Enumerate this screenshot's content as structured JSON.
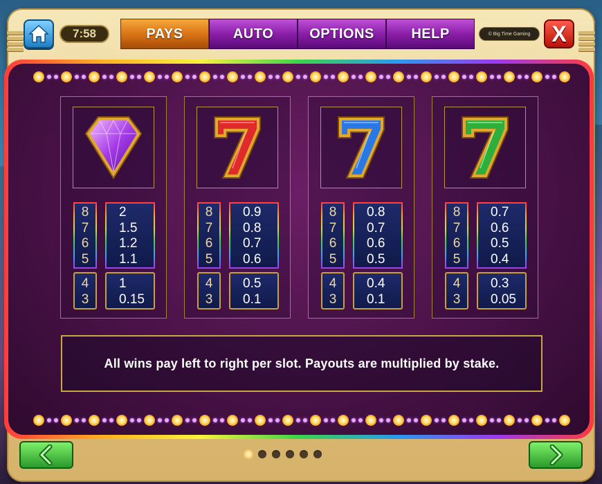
{
  "header": {
    "clock": "7:58",
    "tabs": [
      {
        "label": "PAYS",
        "active": true
      },
      {
        "label": "AUTO",
        "active": false
      },
      {
        "label": "OPTIONS",
        "active": false
      },
      {
        "label": "HELP",
        "active": false
      }
    ],
    "brand": "© Big Time Gaming",
    "close_label": "X"
  },
  "paytable": [
    {
      "symbol": "purple-diamond",
      "symbol_color": "#a63ce8",
      "counts_high": [
        "8",
        "7",
        "6",
        "5"
      ],
      "payouts_high": [
        "2",
        "1.5",
        "1.2",
        "1.1"
      ],
      "counts_low": [
        "4",
        "3"
      ],
      "payouts_low": [
        "1",
        "0.15"
      ]
    },
    {
      "symbol": "red-seven",
      "symbol_color": "#e02a2a",
      "counts_high": [
        "8",
        "7",
        "6",
        "5"
      ],
      "payouts_high": [
        "0.9",
        "0.8",
        "0.7",
        "0.6"
      ],
      "counts_low": [
        "4",
        "3"
      ],
      "payouts_low": [
        "0.5",
        "0.1"
      ]
    },
    {
      "symbol": "blue-seven",
      "symbol_color": "#2a78e6",
      "counts_high": [
        "8",
        "7",
        "6",
        "5"
      ],
      "payouts_high": [
        "0.8",
        "0.7",
        "0.6",
        "0.5"
      ],
      "counts_low": [
        "4",
        "3"
      ],
      "payouts_low": [
        "0.4",
        "0.1"
      ]
    },
    {
      "symbol": "green-seven",
      "symbol_color": "#2eae3a",
      "counts_high": [
        "8",
        "7",
        "6",
        "5"
      ],
      "payouts_high": [
        "0.7",
        "0.6",
        "0.5",
        "0.4"
      ],
      "counts_low": [
        "4",
        "3"
      ],
      "payouts_low": [
        "0.3",
        "0.05"
      ]
    }
  ],
  "info_text": "All wins pay left to right per slot. Payouts are multiplied by stake.",
  "pager": {
    "total": 6,
    "current": 1
  },
  "nav": {
    "prev_icon": "chevron-left-icon",
    "next_icon": "chevron-right-icon"
  }
}
